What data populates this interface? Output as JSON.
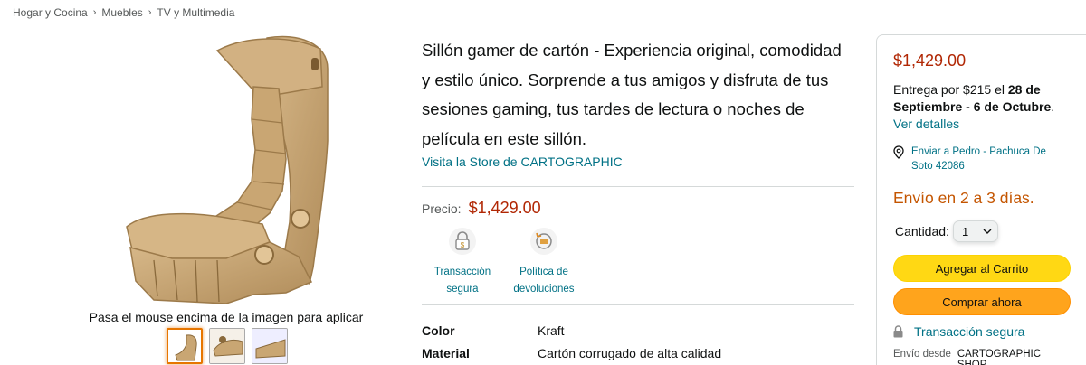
{
  "breadcrumb": [
    "Hogar y Cocina",
    "Muebles",
    "TV y Multimedia"
  ],
  "gallery": {
    "main_image": "cardboard-gaming-chair",
    "zoom_hint": "Pasa el mouse encima de la imagen para aplicar zoom",
    "thumbnails": [
      "chair-thumb-1",
      "chair-thumb-2",
      "chair-thumb-3"
    ]
  },
  "product": {
    "title": "Sillón gamer de cartón - Experiencia original, comodidad y estilo único. Sorprende a tus amigos y disfruta de tus sesiones gaming, tus tardes de lectura o noches de película en este sillón.",
    "store_link": "Visita la Store de CARTOGRAPHIC",
    "price_label": "Precio:",
    "price": "$1,429.00",
    "badges": [
      {
        "label": "Transacción segura",
        "icon": "secure-payment-icon"
      },
      {
        "label": "Política de devoluciones",
        "icon": "returns-icon"
      }
    ],
    "specs": [
      {
        "key": "Color",
        "value": "Kraft"
      },
      {
        "key": "Material",
        "value": "Cartón corrugado de alta calidad"
      }
    ]
  },
  "buybox": {
    "price": "$1,429.00",
    "delivery_prefix": "Entrega por $215 el ",
    "delivery_dates": "28 de Septiembre - 6 de Octubre",
    "delivery_suffix": ". ",
    "details_link": "Ver detalles",
    "location": "Enviar a Pedro - Pachuca De Soto 42086",
    "stock": "Envío en 2 a 3 días.",
    "qty_label": "Cantidad:",
    "qty_value": "1",
    "add_to_cart": "Agregar al Carrito",
    "buy_now": "Comprar ahora",
    "secure": "Transacción segura",
    "ships_from_label": "Envío desde",
    "ships_from_value": "CARTOGRAPHIC SHOP"
  },
  "colors": {
    "price": "#b12704",
    "link": "#007185",
    "cart": "#ffd814",
    "buy": "#ffa41c",
    "stock": "#c45500"
  }
}
